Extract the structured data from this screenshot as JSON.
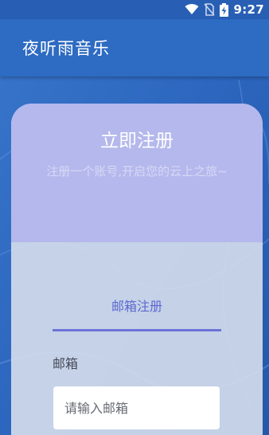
{
  "status_bar": {
    "time": "9:27",
    "icons": [
      "wifi-icon",
      "no-sim-icon",
      "battery-charging-icon"
    ]
  },
  "app_bar": {
    "title": "夜听雨音乐"
  },
  "card": {
    "title": "立即注册",
    "subtitle": "注册一个账号,开启您的云上之旅~"
  },
  "tab": {
    "label": "邮箱注册"
  },
  "email_field": {
    "label": "邮箱",
    "placeholder": "请输入邮箱",
    "value": ""
  },
  "colors": {
    "app_bar": "#2e6bc2",
    "card_header": "#b4b8ec",
    "tab_accent": "#6c73d8"
  }
}
